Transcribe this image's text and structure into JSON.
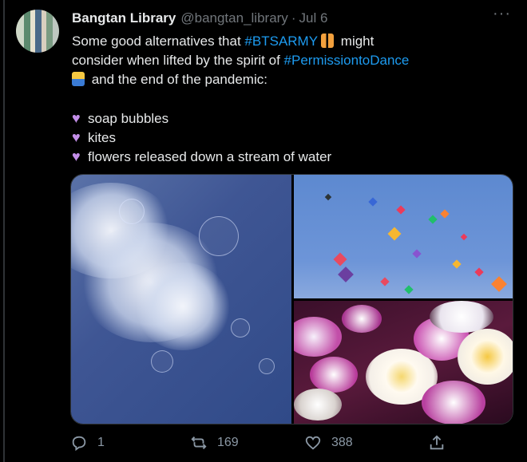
{
  "tweet": {
    "display_name": "Bangtan Library",
    "handle": "@bangtan_library",
    "separator": "·",
    "date": "Jul 6",
    "more_label": "···",
    "line1_pre": "Some good alternatives that ",
    "line1_tag": "#BTSARMY",
    "line1_post": " might",
    "line2_pre": "consider when lifted by the spirit of ",
    "line2_tag": "#PermissiontoDance",
    "line3": " and the end of the pandemic:",
    "list": [
      "soap bubbles",
      "kites",
      "flowers released down a stream of water"
    ]
  },
  "metrics": {
    "replies": "1",
    "retweets": "169",
    "likes": "388"
  },
  "icons": {
    "heart_color": "#c38ee8",
    "link_color": "#1d9bf0",
    "metric_color": "#8b98a5"
  }
}
